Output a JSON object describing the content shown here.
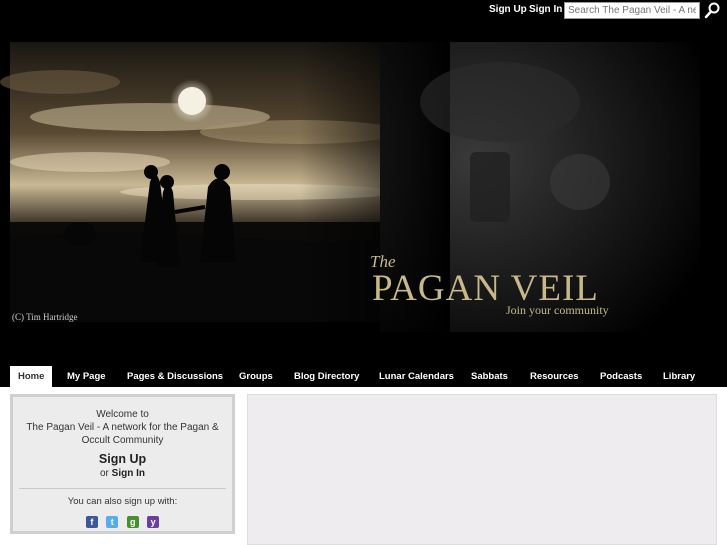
{
  "topbar": {
    "signup_label": "Sign Up",
    "signin_label": "Sign In",
    "search_placeholder": "Search The Pagan Veil - A network",
    "search_icon": "search-icon"
  },
  "banner": {
    "title_the": "The",
    "title_main": "PAGAN VEIL",
    "tagline": "Join your community",
    "credit": "(C) Tim Hartridge"
  },
  "nav": {
    "tabs": [
      {
        "label": "Home",
        "active": true
      },
      {
        "label": "My Page"
      },
      {
        "label": "Pages & Discussions"
      },
      {
        "label": "Groups"
      },
      {
        "label": "Blog Directory"
      },
      {
        "label": "Lunar Calendars"
      },
      {
        "label": "Sabbats"
      },
      {
        "label": "Resources"
      },
      {
        "label": "Podcasts"
      },
      {
        "label": "Library"
      }
    ]
  },
  "welcome": {
    "line1": "Welcome to",
    "line2": "The Pagan Veil - A network for the Pagan & Occult Community",
    "signup": "Sign Up",
    "or": "or",
    "signin": "Sign In",
    "also": "You can also sign up with:",
    "socials": [
      {
        "icon": "facebook-icon",
        "glyph": "f",
        "color": "#3b5998"
      },
      {
        "icon": "twitter-icon",
        "glyph": "t",
        "color": "#55acee"
      },
      {
        "icon": "google-icon",
        "glyph": "g",
        "color": "#4a8f2e"
      },
      {
        "icon": "yahoo-icon",
        "glyph": "y",
        "color": "#6b3fa0"
      }
    ]
  },
  "colors": {
    "accent_text": "#c8b98a",
    "nav_bg": "#000000",
    "panel_bg": "#ececec"
  }
}
